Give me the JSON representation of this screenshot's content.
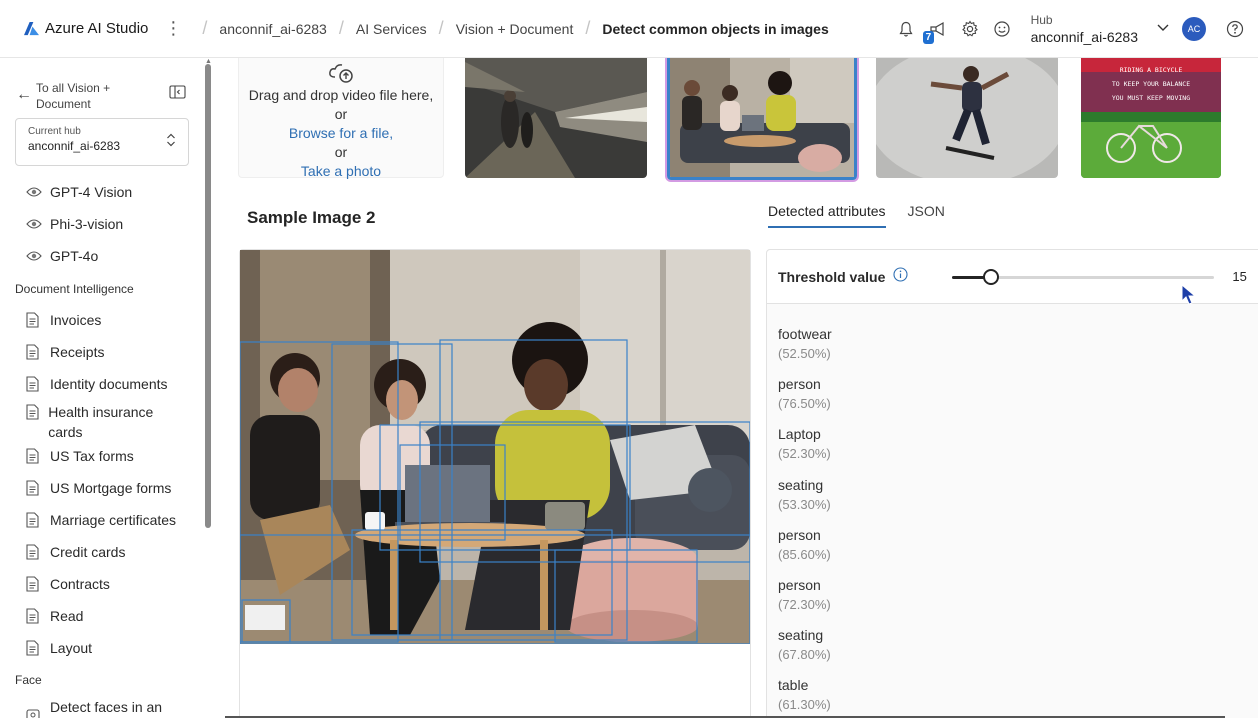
{
  "topbar": {
    "brand": "Azure AI Studio",
    "breadcrumbs": [
      "anconnif_ai-6283",
      "AI Services",
      "Vision + Document",
      "Detect common objects in images"
    ],
    "notification_badge": "7",
    "hub_label": "Hub",
    "hub_value": "anconnif_ai-6283",
    "avatar_initials": "AC"
  },
  "sidebar": {
    "back_label": "To all Vision + Document",
    "current_hub_label": "Current hub",
    "current_hub_value": "anconnif_ai-6283",
    "items": [
      {
        "label": "GPT-4 Vision",
        "icon": "eye-icon"
      },
      {
        "label": "Phi-3-vision",
        "icon": "eye-icon"
      },
      {
        "label": "GPT-4o",
        "icon": "eye-icon"
      }
    ],
    "doc_section": "Document Intelligence",
    "doc_items": [
      {
        "label": "Invoices"
      },
      {
        "label": "Receipts"
      },
      {
        "label": "Identity documents"
      },
      {
        "label": "Health insurance cards"
      },
      {
        "label": "US Tax forms"
      },
      {
        "label": "US Mortgage forms"
      },
      {
        "label": "Marriage certificates"
      },
      {
        "label": "Credit cards"
      },
      {
        "label": "Contracts"
      },
      {
        "label": "Read"
      },
      {
        "label": "Layout"
      }
    ],
    "face_section": "Face",
    "face_items": [
      {
        "label": "Detect faces in an"
      }
    ]
  },
  "upload": {
    "drag_text": "Drag and drop video file here,",
    "or1": "or",
    "browse": "Browse for a file,",
    "or2": "or",
    "photo": "Take a photo"
  },
  "thumbnails": [
    {
      "name": "subway-station-thumbnail",
      "selected": false
    },
    {
      "name": "office-meeting-thumbnail",
      "selected": true
    },
    {
      "name": "skateboarder-thumbnail",
      "selected": false
    },
    {
      "name": "bicycle-poster-thumbnail",
      "selected": false
    }
  ],
  "poster_text": [
    "RIDING A BICYCLE",
    "TO KEEP YOUR BALANCE",
    "YOU MUST KEEP MOVING"
  ],
  "sample_title": "Sample Image 2",
  "tabs": [
    {
      "label": "Detected attributes",
      "active": true
    },
    {
      "label": "JSON",
      "active": false
    }
  ],
  "threshold": {
    "label": "Threshold value",
    "value": "15",
    "level": 0.15
  },
  "attributes": [
    {
      "name": "footwear",
      "confidence": "(52.50%)"
    },
    {
      "name": "person",
      "confidence": "(76.50%)"
    },
    {
      "name": "Laptop",
      "confidence": "(52.30%)"
    },
    {
      "name": "seating",
      "confidence": "(53.30%)"
    },
    {
      "name": "person",
      "confidence": "(85.60%)"
    },
    {
      "name": "person",
      "confidence": "(72.30%)"
    },
    {
      "name": "seating",
      "confidence": "(67.80%)"
    },
    {
      "name": "table",
      "confidence": "(61.30%)"
    }
  ],
  "colors": {
    "accent": "#2f6fb3",
    "bbox": "#3a82c9",
    "avatar": "#2b5bbd"
  }
}
